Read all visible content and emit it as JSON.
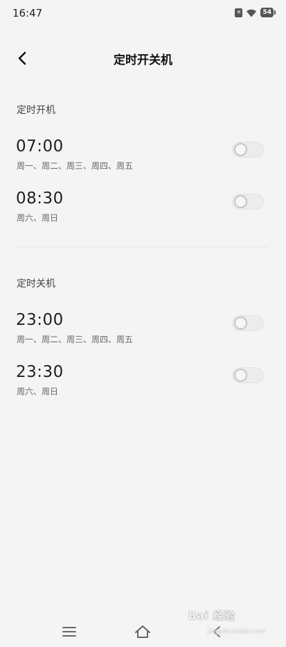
{
  "status_bar": {
    "time": "16:47",
    "sim_icon": "sim-off-icon",
    "wifi_icon": "wifi-icon",
    "battery_level": "54"
  },
  "header": {
    "back_icon": "chevron-left-icon",
    "title": "定时开关机"
  },
  "power_on": {
    "section_label": "定时开机",
    "items": [
      {
        "time": "07:00",
        "days": "周一、周二、周三、周四、周五",
        "enabled": false
      },
      {
        "time": "08:30",
        "days": "周六、周日",
        "enabled": false
      }
    ]
  },
  "power_off": {
    "section_label": "定时关机",
    "items": [
      {
        "time": "23:00",
        "days": "周一、周二、周三、周四、周五",
        "enabled": false
      },
      {
        "time": "23:30",
        "days": "周六、周日",
        "enabled": false
      }
    ]
  },
  "nav_bar": {
    "menu_icon": "menu-icon",
    "home_icon": "home-icon",
    "back_icon": "back-nav-icon"
  },
  "watermark": {
    "text": "Bai 经验",
    "sub": "jingyan.baidu.com"
  }
}
